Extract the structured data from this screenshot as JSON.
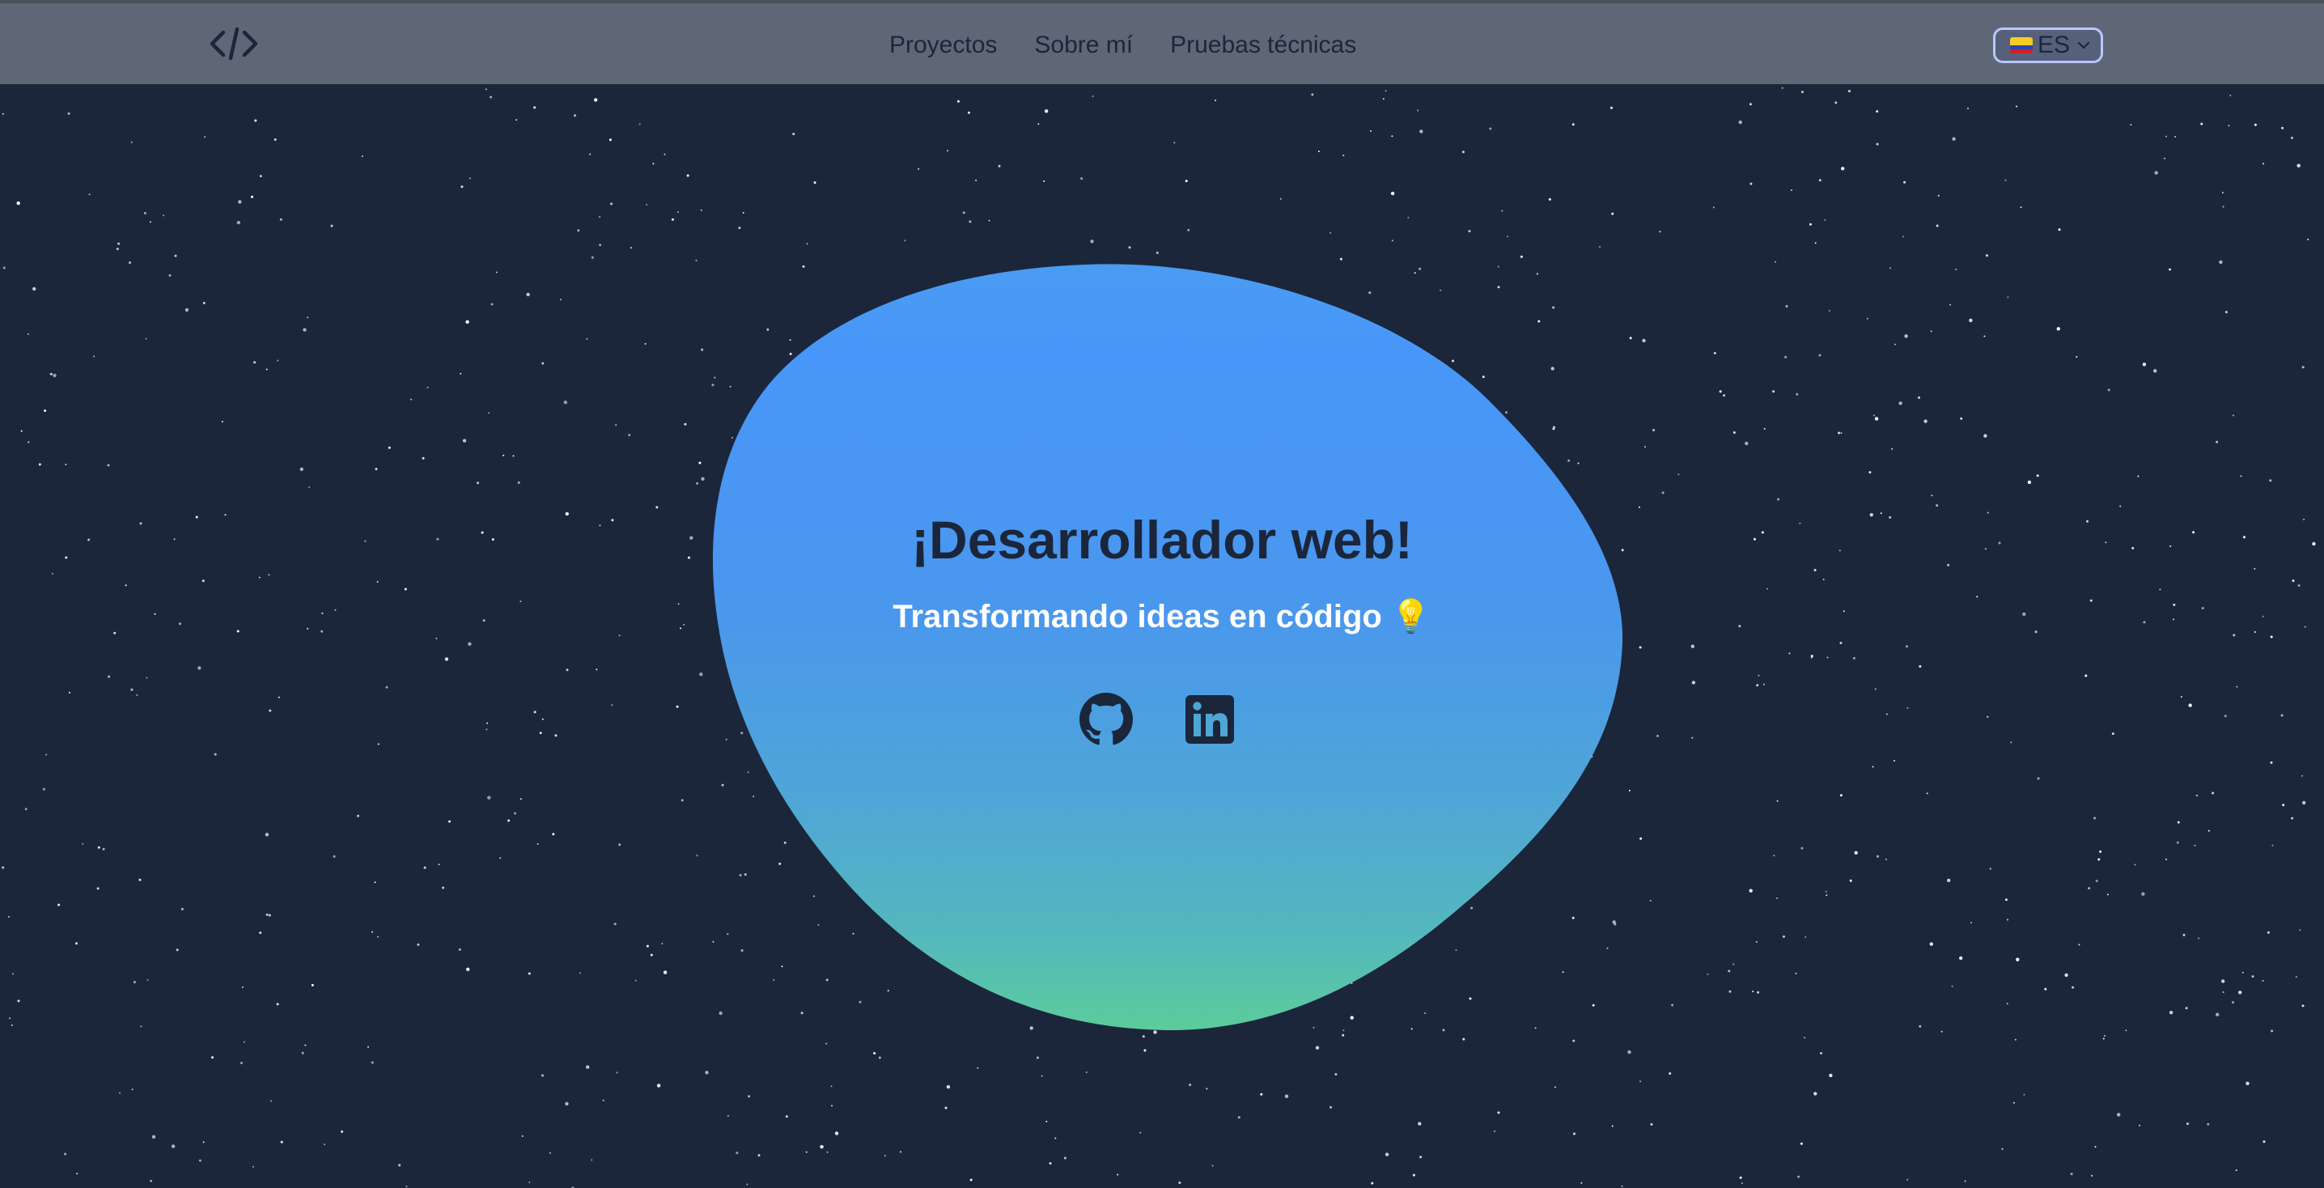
{
  "header": {
    "logo_icon": "code-brackets-icon",
    "nav": [
      {
        "label": "Proyectos"
      },
      {
        "label": "Sobre mí"
      },
      {
        "label": "Pruebas técnicas"
      }
    ],
    "language": {
      "selected": "ES",
      "flag_icon": "ecuador-flag-icon"
    }
  },
  "hero": {
    "title": "¡Desarrollador web!",
    "subtitle": "Transformando ideas en código 💡",
    "social": [
      {
        "icon": "github-icon"
      },
      {
        "icon": "linkedin-icon"
      }
    ]
  },
  "colors": {
    "background": "#1b263b",
    "navbar": "#5f6776",
    "blob_top": "#4897f8",
    "blob_bottom": "#5bc9a1",
    "text_dark": "#1b263b",
    "text_light": "#ffffff"
  }
}
